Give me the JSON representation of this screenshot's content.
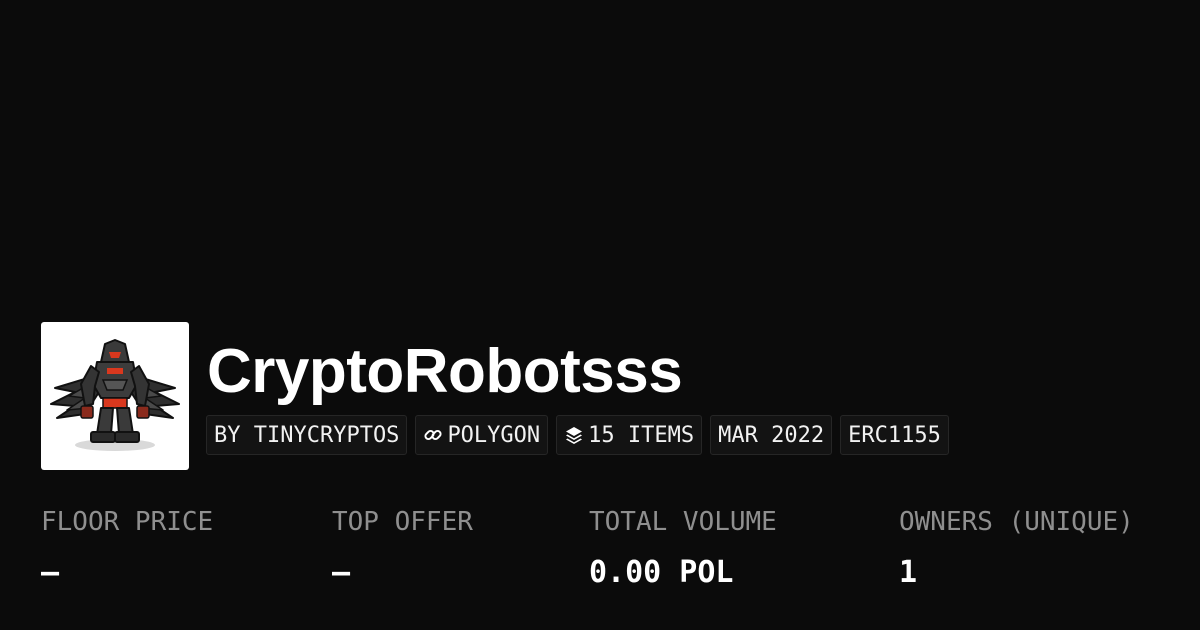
{
  "collection": {
    "name": "CryptoRobotsss",
    "avatar_icon": "robot-mech-icon"
  },
  "chips": [
    {
      "label": "BY TINYCRYPTOS"
    },
    {
      "label": "POLYGON",
      "icon": "link-icon"
    },
    {
      "label": "15 ITEMS",
      "icon": "layers-icon"
    },
    {
      "label": "MAR 2022"
    },
    {
      "label": "ERC1155"
    }
  ],
  "stats": [
    {
      "label": "FLOOR PRICE",
      "value": "–"
    },
    {
      "label": "TOP OFFER",
      "value": "–"
    },
    {
      "label": "TOTAL VOLUME",
      "value": "0.00 POL"
    },
    {
      "label": "OWNERS (UNIQUE)",
      "value": "1"
    }
  ],
  "colors": {
    "background": "#0b0b0b",
    "chip_background": "#131313",
    "chip_border": "#262626",
    "label_gray": "#8f8f8f",
    "text": "#ffffff",
    "robot_accent": "#d9381e"
  }
}
